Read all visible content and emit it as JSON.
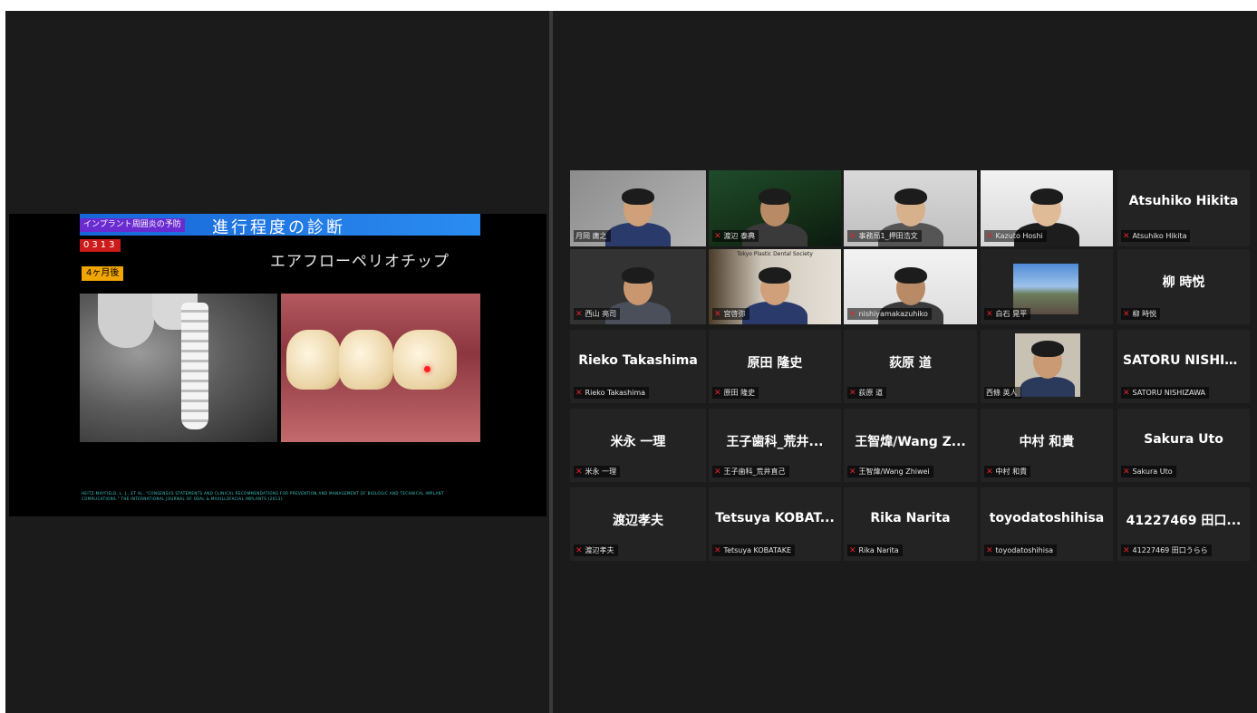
{
  "slide": {
    "tag": "インプラント周囲炎の予防",
    "title": "進行程度の診断",
    "code": "0313",
    "months": "4ヶ月後",
    "subtitle": "エアフローペリオチップ",
    "reference": "HEITZ-MAYFIELD, L. J., ET AL. \"CONSENSUS STATEMENTS AND CLINICAL RECOMMENDATIONS FOR PREVENTION AND MANAGEMENT OF BIOLOGIC AND TECHNICAL IMPLANT COMPLICATIONS.\" THE INTERNATIONAL JOURNAL OF ORAL & MAXILLOFACIAL IMPLANTS (2013)."
  },
  "gallery": {
    "accent_color": "#b6d531",
    "muted_mic_color": "#e0242c",
    "rows": [
      [
        {
          "type": "video",
          "caption": "月岡 庸之",
          "muted": false,
          "active": true
        },
        {
          "type": "video",
          "caption": "渡辺 泰典",
          "muted": true
        },
        {
          "type": "video",
          "caption": "事務局1_押田浩文",
          "muted": true
        },
        {
          "type": "video",
          "caption": "Kazuto Hoshi",
          "muted": true
        },
        {
          "type": "name",
          "display": "Atsuhiko Hikita",
          "caption": "Atsuhiko Hikita",
          "muted": true
        }
      ],
      [
        {
          "type": "video",
          "caption": "西山 亮司",
          "muted": true
        },
        {
          "type": "video",
          "caption": "宮啓弥",
          "muted": true,
          "banner": "Tokyo Plastic Dental Society"
        },
        {
          "type": "video",
          "caption": "nishiyamakazuhiko",
          "muted": true
        },
        {
          "type": "video",
          "caption": "白石 晃平",
          "muted": true
        },
        {
          "type": "name",
          "display": "柳 時悦",
          "caption": "柳 時悦",
          "muted": true
        }
      ],
      [
        {
          "type": "name",
          "display": "Rieko Takashima",
          "caption": "Rieko Takashima",
          "muted": true
        },
        {
          "type": "name",
          "display": "原田 隆史",
          "caption": "原田 隆史",
          "muted": true
        },
        {
          "type": "name",
          "display": "荻原 道",
          "caption": "荻原 道",
          "muted": true
        },
        {
          "type": "photo",
          "caption": "西條 英人",
          "muted": false
        },
        {
          "type": "name",
          "display": "SATORU NISHIZ...",
          "caption": "SATORU NISHIZAWA",
          "muted": true
        }
      ],
      [
        {
          "type": "name",
          "display": "米永 一理",
          "caption": "米永 一理",
          "muted": true
        },
        {
          "type": "name",
          "display": "王子歯科_荒井...",
          "caption": "王子歯科_荒井直己",
          "muted": true
        },
        {
          "type": "name",
          "display": "王智煒/Wang Z...",
          "caption": "王智煒/Wang Zhiwei",
          "muted": true
        },
        {
          "type": "name",
          "display": "中村 和貴",
          "caption": "中村 和貴",
          "muted": true
        },
        {
          "type": "name",
          "display": "Sakura Uto",
          "caption": "Sakura Uto",
          "muted": true
        }
      ],
      [
        {
          "type": "name",
          "display": "渡辺孝夫",
          "caption": "渡辺孝夫",
          "muted": true
        },
        {
          "type": "name",
          "display": "Tetsuya KOBAT...",
          "caption": "Tetsuya KOBATAKE",
          "muted": true
        },
        {
          "type": "name",
          "display": "Rika Narita",
          "caption": "Rika Narita",
          "muted": true
        },
        {
          "type": "name",
          "display": "toyodatoshihisa",
          "caption": "toyodatoshihisa",
          "muted": true
        },
        {
          "type": "name",
          "display": "41227469 田口...",
          "caption": "41227469 田口うらら",
          "muted": true
        }
      ]
    ]
  }
}
